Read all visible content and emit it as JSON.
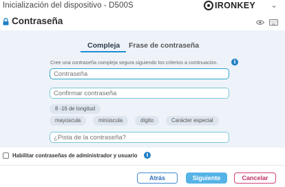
{
  "window": {
    "title": "Inicialización del dispositivo - D500S",
    "brand": "IRONKEY"
  },
  "header": {
    "title": "Contraseña"
  },
  "tabs": [
    {
      "label": "Compleja",
      "active": true
    },
    {
      "label": "Frase de contraseña",
      "active": false
    }
  ],
  "form": {
    "instructions": "Cree una contraseña compleja segura siguiendo los criterios a continuación.",
    "password_placeholder": "Contraseña",
    "confirm_placeholder": "Confirmar contraseña",
    "hint_placeholder": "¿Pista de la contraseña?"
  },
  "criteria": {
    "length": "8 -16 de longitud",
    "uppercase": "mayúscula",
    "lowercase": "minúscula",
    "digit": "dígito",
    "special": "Carácter especial"
  },
  "admin": {
    "label": "Habilitar contraseñas de administrador y usuario",
    "checked": false
  },
  "buttons": {
    "back": "Atrás",
    "next": "Siguiente",
    "cancel": "Cancelar"
  },
  "colors": {
    "accent": "#1f8ed4",
    "panel_bg": "#eef3f9",
    "next_bg": "#56b3e6",
    "cancel_border": "#d13e78"
  }
}
